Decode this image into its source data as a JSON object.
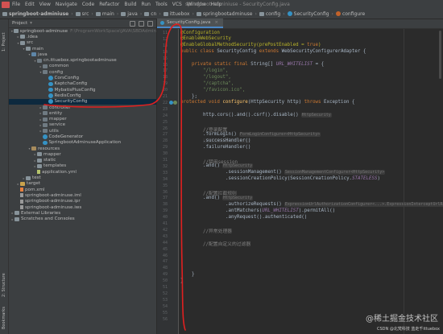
{
  "menubar": {
    "items": [
      "File",
      "Edit",
      "View",
      "Navigate",
      "Code",
      "Refactor",
      "Build",
      "Run",
      "Tools",
      "VCS",
      "Window",
      "Help"
    ],
    "window_title": "springboot-adminiuse - SecurityConfig.java"
  },
  "navbar": {
    "crumbs": [
      "springboot-adminiuse",
      "src",
      "main",
      "java",
      "cn",
      "ittuebox",
      "springbootadminuse",
      "config",
      "SecurityConfig",
      "configure"
    ]
  },
  "left_strip": {
    "project_label": "1: Project",
    "structure_label": "2: Structure",
    "bookmarks_label": "Bookmarks"
  },
  "project_panel": {
    "header": "Project",
    "root_path": "F:\\ProgramWorkSpace\\JAVA\\SBDAdmin",
    "tree": [
      {
        "label": "springboot-adminuse",
        "depth": 0,
        "icon": "folder",
        "sub": "F:\\ProgramWorkSpace\\JAVA\\SBDAdmin",
        "expanded": true
      },
      {
        "label": ".idea",
        "depth": 1,
        "icon": "folder"
      },
      {
        "label": "src",
        "depth": 1,
        "icon": "folder",
        "expanded": true
      },
      {
        "label": "main",
        "depth": 2,
        "icon": "folder",
        "expanded": true
      },
      {
        "label": "java",
        "depth": 3,
        "icon": "src",
        "expanded": true
      },
      {
        "label": "cn.ittuebox.springbootadminuse",
        "depth": 4,
        "icon": "pkg",
        "expanded": true
      },
      {
        "label": "common",
        "depth": 5,
        "icon": "pkg"
      },
      {
        "label": "config",
        "depth": 5,
        "icon": "pkg",
        "expanded": true
      },
      {
        "label": "CorsConfig",
        "depth": 6,
        "icon": "cls"
      },
      {
        "label": "KaptchaConfig",
        "depth": 6,
        "icon": "cls"
      },
      {
        "label": "MybatisPlusConfig",
        "depth": 6,
        "icon": "cls"
      },
      {
        "label": "RedisConfig",
        "depth": 6,
        "icon": "cls"
      },
      {
        "label": "SecurityConfig",
        "depth": 6,
        "icon": "cls",
        "selected": true
      },
      {
        "label": "controller",
        "depth": 5,
        "icon": "pkg"
      },
      {
        "label": "entity",
        "depth": 5,
        "icon": "pkg"
      },
      {
        "label": "mapper",
        "depth": 5,
        "icon": "pkg"
      },
      {
        "label": "service",
        "depth": 5,
        "icon": "pkg"
      },
      {
        "label": "utils",
        "depth": 5,
        "icon": "pkg"
      },
      {
        "label": "CodeGenerator",
        "depth": 5,
        "icon": "cls"
      },
      {
        "label": "SpringbootAdminuseApplication",
        "depth": 5,
        "icon": "cls"
      },
      {
        "label": "resources",
        "depth": 3,
        "icon": "res",
        "expanded": true
      },
      {
        "label": "mapper",
        "depth": 4,
        "icon": "folder"
      },
      {
        "label": "static",
        "depth": 4,
        "icon": "folder"
      },
      {
        "label": "templates",
        "depth": 4,
        "icon": "folder"
      },
      {
        "label": "application.yml",
        "depth": 4,
        "icon": "yml"
      },
      {
        "label": "test",
        "depth": 2,
        "icon": "folder"
      },
      {
        "label": "target",
        "depth": 1,
        "icon": "target"
      },
      {
        "label": "pom.xml",
        "depth": 1,
        "icon": "xml"
      },
      {
        "label": "springboot-adminuse.iml",
        "depth": 1,
        "icon": "file"
      },
      {
        "label": "springboot-adminuse.ipr",
        "depth": 1,
        "icon": "file"
      },
      {
        "label": "springboot-adminuse.iws",
        "depth": 1,
        "icon": "file"
      },
      {
        "label": "External Libraries",
        "depth": 0,
        "icon": "folder"
      },
      {
        "label": "Scratches and Consoles",
        "depth": 0,
        "icon": "folder"
      }
    ]
  },
  "editor": {
    "tab_label": "SecurityConfig.java",
    "lines": [
      {
        "n": "17",
        "html_key": "l17"
      },
      {
        "n": "18",
        "html_key": "l18"
      },
      {
        "n": "19",
        "html_key": "l19"
      },
      {
        "n": "20",
        "html_key": "l20"
      },
      {
        "n": "21",
        "html_key": "l21"
      },
      {
        "n": "22",
        "html_key": "l22"
      }
    ],
    "code": {
      "l01": "@Configuration",
      "l02": "@EnableWebSecurity",
      "l03a": "@EnableGlobalMethodSecurity(prePostEnabled = ",
      "l03b": "true",
      "l03c": ")",
      "l04a": "public class ",
      "l04b": "SecurityConfig ",
      "l04c": "extends ",
      "l04d": "WebSecurityConfigurerAdapter {",
      "l06a": "private static final ",
      "l06b": "String[] ",
      "l06c": "URL_WHITELIST",
      "l06d": " = {",
      "l07": "\"/login\",",
      "l08": "\"/logout\",",
      "l09": "\"/captcha\",",
      "l10": "\"/favicon.ico\",",
      "l11": "};",
      "l12a": "protected void ",
      "l12b": "configure",
      "l12c": "(HttpSecurity http) ",
      "l12d": "throws ",
      "l12e": "Exception {",
      "l14": "http.cors().and().csrf().disable()",
      "l14h": "HttpSecurity",
      "l16": "//登录配置",
      "l17": ".formLogin()",
      "l17h": "FormLoginConfigurer<HttpSecurity>",
      "l18": ".successHandler()",
      "l19": ".failureHandler()",
      "l21": "//禁用session",
      "l22": ".and()",
      "l22h": "HttpSecurity",
      "l23": ".sessionManagement()",
      "l23h": "SessionManagementConfigurer<HttpSecurity>",
      "l24a": ".sessionCreationPolicy(SessionCreationPolicy.",
      "l24b": "STATELESS",
      "l24c": ")",
      "l26": "//配置拦截规则",
      "l27": ".and()",
      "l27h": "HttpSecurity",
      "l28": ".authorizeRequests()",
      "l28h": "ExpressionUrlAuthorizationConfigurer<...>.ExpressionInterceptUrlRegistry",
      "l29a": ".antMatchers(",
      "l29b": "URL_WHITELIST",
      "l29c": ").permitAll()",
      "l30": ".anyRequest().authenticated()",
      "l32": "//异常处理器",
      "l34": "//配置自定义的过滤器",
      "l36": "}",
      "l37": "}"
    },
    "line_numbers": [
      "11",
      "12",
      "13",
      "14",
      "15",
      "16",
      "17",
      "18",
      "19",
      "20",
      "21",
      "22",
      "23",
      "24",
      "25",
      "26",
      "27",
      "28",
      "29",
      "30",
      "31",
      "32",
      "33",
      "34",
      "35",
      "36",
      "37",
      "38",
      "39",
      "40",
      "41",
      "42",
      "43",
      "44",
      "45",
      "46",
      "47",
      "48",
      "49",
      "50",
      "51",
      "52",
      "53",
      "54",
      "55",
      "56"
    ]
  },
  "watermark": {
    "main": "@稀土掘金技术社区",
    "sub": "CSDN @北梵科技 蓝走千ittuebox"
  },
  "colors": {
    "annotation": "#bbb529",
    "keyword": "#cc7832",
    "string": "#6a8759",
    "comment": "#808080",
    "field": "#9876aa",
    "method": "#ffc66d",
    "selection": "#0d293e",
    "red_annotation": "#e02020"
  }
}
